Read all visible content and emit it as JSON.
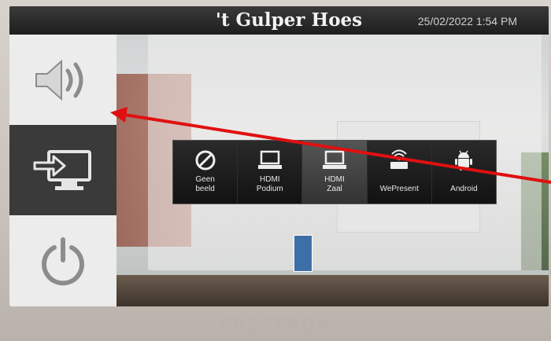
{
  "device": {
    "brand": "CRESTRON"
  },
  "header": {
    "title": "'t Gulper Hoes",
    "datetime": "25/02/2022 1:54 PM"
  },
  "nav": {
    "items": [
      {
        "icon": "speaker-volume-icon"
      },
      {
        "icon": "display-input-icon"
      },
      {
        "icon": "power-icon"
      }
    ]
  },
  "sources": [
    {
      "icon": "no-image-icon",
      "line1": "Geen",
      "line2": "beeld",
      "selected": false
    },
    {
      "icon": "laptop-icon",
      "line1": "HDMI",
      "line2": "Podium",
      "selected": false
    },
    {
      "icon": "laptop-icon",
      "line1": "HDMI",
      "line2": "Zaal",
      "selected": true
    },
    {
      "icon": "wireless-presenter-icon",
      "line1": "",
      "line2": "WePresent",
      "selected": false
    },
    {
      "icon": "android-icon",
      "line1": "",
      "line2": "Android",
      "selected": false
    }
  ],
  "annotation": {
    "color": "#e01010"
  }
}
